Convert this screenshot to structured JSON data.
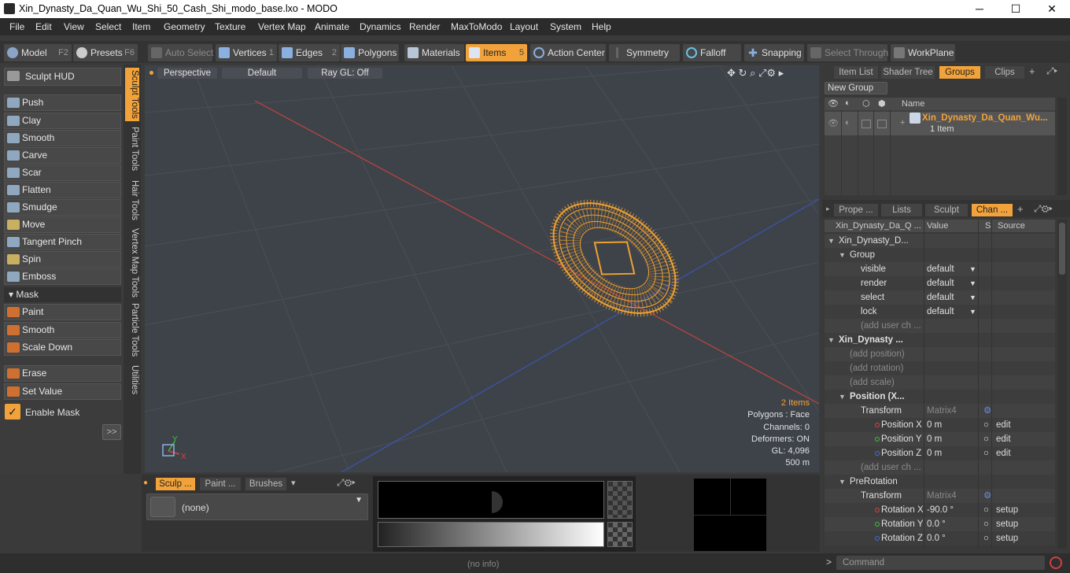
{
  "window": {
    "title": "Xin_Dynasty_Da_Quan_Wu_Shi_50_Cash_Shi_modo_base.lxo - MODO",
    "minimize": "─",
    "maximize": "☐",
    "close": "✕"
  },
  "menu": [
    "File",
    "Edit",
    "View",
    "Select",
    "Item",
    "Geometry",
    "Texture",
    "Vertex Map",
    "Animate",
    "Dynamics",
    "Render",
    "MaxToModo",
    "Layout",
    "System",
    "Help"
  ],
  "toolbar": {
    "model": "Model",
    "model_key": "F2",
    "presets": "Presets",
    "presets_key": "F6",
    "auto_select": "Auto Select",
    "vertices": "Vertices",
    "vertices_key": "1",
    "edges": "Edges",
    "edges_key": "2",
    "polygons": "Polygons",
    "materials": "Materials",
    "items": "Items",
    "items_key": "5",
    "action_center": "Action Center",
    "symmetry": "Symmetry",
    "falloff": "Falloff",
    "snapping": "Snapping",
    "select_through": "Select Through",
    "workplane": "WorkPlane"
  },
  "left": {
    "sculpt_hud": "Sculpt HUD",
    "tools": [
      "Push",
      "Clay",
      "Smooth",
      "Carve",
      "Scar",
      "Flatten",
      "Smudge",
      "Move",
      "Tangent Pinch",
      "Spin",
      "Emboss"
    ],
    "mask_header": "Mask",
    "mask_tools": [
      "Paint",
      "Smooth",
      "Scale Down"
    ],
    "other_tools": [
      "Erase",
      "Set Value"
    ],
    "enable_mask": "Enable Mask",
    "expand": ">>"
  },
  "vtabs": [
    "Sculpt Tools",
    "Paint Tools",
    "Hair Tools",
    "Vertex Map Tools",
    "Particle Tools",
    "Utilities"
  ],
  "viewport": {
    "view": "Perspective",
    "style": "Default",
    "raygl": "Ray GL: Off",
    "stats": {
      "items": "2 Items",
      "polygons": "Polygons : Face",
      "channels": "Channels: 0",
      "deformers": "Deformers: ON",
      "gl": "GL: 4,096",
      "scale": "500 m"
    },
    "axis_y": "Y",
    "axis_x": "X"
  },
  "bottom": {
    "tabs": [
      "Sculp ...",
      "Paint ...",
      "Brushes"
    ],
    "brush": "(none)"
  },
  "right": {
    "top_tabs": [
      "Item List",
      "Shader Tree",
      "Groups",
      "Clips"
    ],
    "new_group": "New Group",
    "name_col": "Name",
    "group_name": "Xin_Dynasty_Da_Quan_Wu...",
    "group_count": "1 Item",
    "mid_tabs": [
      "Prope ...",
      "Lists",
      "Sculpt",
      "Chan ..."
    ],
    "chan_header": {
      "name": "Xin_Dynasty_Da_Q ...",
      "value": "Value",
      "s": "S",
      "source": "Source"
    },
    "rows": [
      {
        "n": "Xin_Dynasty_D...",
        "v": "",
        "s": "",
        "src": "",
        "ind": 0,
        "bold": false,
        "tri": "▼"
      },
      {
        "n": "Group",
        "v": "",
        "s": "",
        "src": "",
        "ind": 1,
        "bold": false,
        "tri": "▼"
      },
      {
        "n": "visible",
        "v": "default",
        "s": "",
        "src": "",
        "ind": 2,
        "bold": false,
        "tri": "",
        "dd": true
      },
      {
        "n": "render",
        "v": "default",
        "s": "",
        "src": "",
        "ind": 2,
        "bold": false,
        "tri": "",
        "dd": true
      },
      {
        "n": "select",
        "v": "default",
        "s": "",
        "src": "",
        "ind": 2,
        "bold": false,
        "tri": "",
        "dd": true
      },
      {
        "n": "lock",
        "v": "default",
        "s": "",
        "src": "",
        "ind": 2,
        "bold": false,
        "tri": "",
        "dd": true
      },
      {
        "n": "(add user ch ...",
        "v": "",
        "s": "",
        "src": "",
        "ind": 2,
        "bold": false,
        "tri": "",
        "dim": true
      },
      {
        "n": "Xin_Dynasty ...",
        "v": "",
        "s": "",
        "src": "",
        "ind": 0,
        "bold": true,
        "tri": "▼"
      },
      {
        "n": "(add position)",
        "v": "",
        "s": "",
        "src": "",
        "ind": 1,
        "bold": false,
        "tri": "",
        "dim": true
      },
      {
        "n": "(add rotation)",
        "v": "",
        "s": "",
        "src": "",
        "ind": 1,
        "bold": false,
        "tri": "",
        "dim": true
      },
      {
        "n": "(add scale)",
        "v": "",
        "s": "",
        "src": "",
        "ind": 1,
        "bold": false,
        "tri": "",
        "dim": true
      },
      {
        "n": "Position (X...",
        "v": "",
        "s": "",
        "src": "",
        "ind": 1,
        "bold": true,
        "tri": "▼"
      },
      {
        "n": "Transform",
        "v": "Matrix4",
        "s": "⚙",
        "src": "",
        "ind": 2,
        "bold": false,
        "tri": "",
        "vdim": true
      },
      {
        "n": "Position X",
        "v": "0 m",
        "s": "○",
        "src": "edit",
        "ind": 2,
        "bold": false,
        "tri": "",
        "dot": "#e04040"
      },
      {
        "n": "Position Y",
        "v": "0 m",
        "s": "○",
        "src": "edit",
        "ind": 2,
        "bold": false,
        "tri": "",
        "dot": "#40c040"
      },
      {
        "n": "Position Z",
        "v": "0 m",
        "s": "○",
        "src": "edit",
        "ind": 2,
        "bold": false,
        "tri": "",
        "dot": "#4070e0"
      },
      {
        "n": "(add user ch ...",
        "v": "",
        "s": "",
        "src": "",
        "ind": 2,
        "bold": false,
        "tri": "",
        "dim": true
      },
      {
        "n": "PreRotation",
        "v": "",
        "s": "",
        "src": "",
        "ind": 1,
        "bold": false,
        "tri": "▼"
      },
      {
        "n": "Transform",
        "v": "Matrix4",
        "s": "⚙",
        "src": "",
        "ind": 2,
        "bold": false,
        "tri": "",
        "vdim": true
      },
      {
        "n": "Rotation X",
        "v": "-90.0 °",
        "s": "○",
        "src": "setup",
        "ind": 2,
        "bold": false,
        "tri": "",
        "dot": "#e04040"
      },
      {
        "n": "Rotation Y",
        "v": "0.0 °",
        "s": "○",
        "src": "setup",
        "ind": 2,
        "bold": false,
        "tri": "",
        "dot": "#40c040"
      },
      {
        "n": "Rotation Z",
        "v": "0.0 °",
        "s": "○",
        "src": "setup",
        "ind": 2,
        "bold": false,
        "tri": "",
        "dot": "#4070e0"
      }
    ]
  },
  "status": {
    "info": "(no info)",
    "command": "Command",
    "prompt": ">"
  },
  "colors": {
    "accent": "#f2a23a",
    "mesh": "#f0a030",
    "x_axis": "#c0443a",
    "z_axis": "#3a55b0"
  }
}
